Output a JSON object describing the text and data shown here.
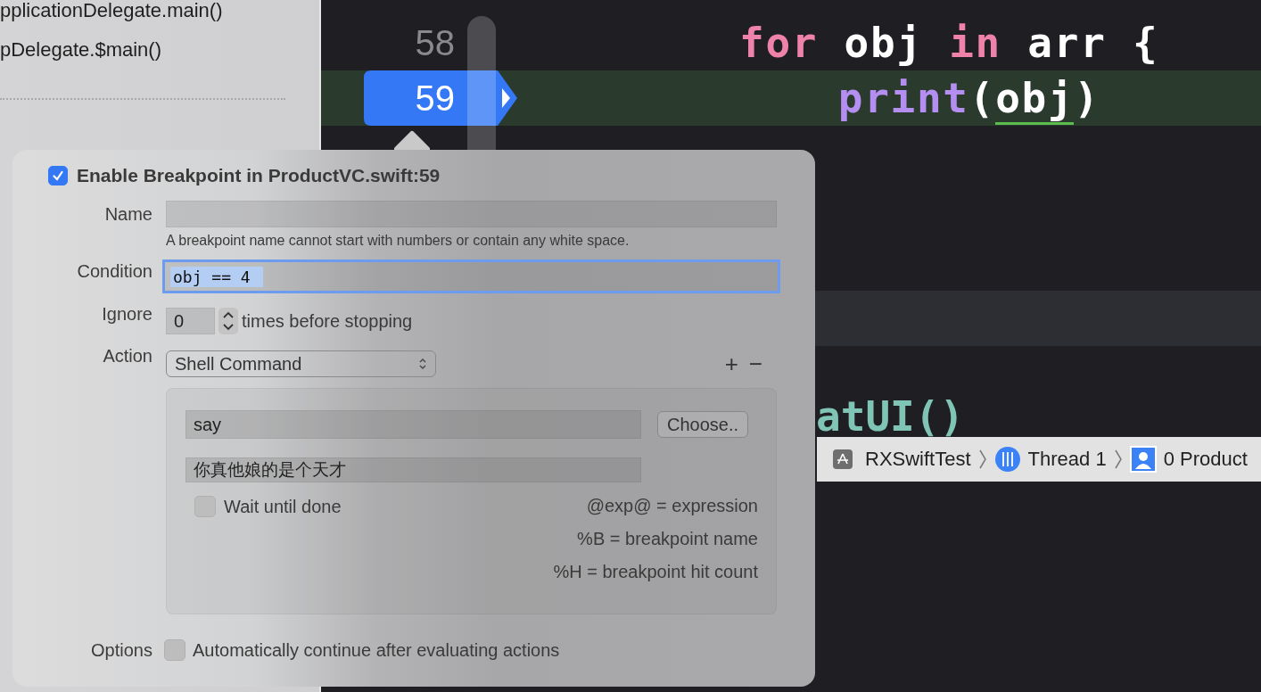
{
  "navigator": {
    "frames": [
      {
        "text": "pplicationDelegate.main()"
      },
      {
        "text": "pDelegate.$main()"
      }
    ]
  },
  "editor": {
    "lines": [
      {
        "number": "58",
        "breakpoint": false,
        "current": false,
        "tokens": [
          {
            "kind": "keyword",
            "text": "for"
          },
          {
            "kind": "plain",
            "text": " obj "
          },
          {
            "kind": "keyword",
            "text": "in"
          },
          {
            "kind": "plain",
            "text": " arr {"
          }
        ],
        "children": [
          {
            "number": "59",
            "breakpoint": true,
            "current": true,
            "tokens": [
              {
                "kind": "function",
                "text": "print"
              },
              {
                "kind": "plain",
                "text": "("
              },
              {
                "kind": "plain",
                "text": "obj",
                "underlined": true
              },
              {
                "kind": "plain",
                "text": ")"
              }
            ]
          }
        ]
      }
    ],
    "tail_code": "atUI()"
  },
  "debug_bar": {
    "items": [
      {
        "kind": "app",
        "label": "RXSwiftTest"
      },
      {
        "kind": "thread",
        "label": "Thread 1"
      },
      {
        "kind": "frame",
        "label": "0 Product"
      }
    ]
  },
  "popover": {
    "enabled": true,
    "title": "Enable Breakpoint in ProductVC.swift:59",
    "name": {
      "label": "Name",
      "hint": "A breakpoint name cannot start with numbers or contain any white space."
    },
    "condition": {
      "label": "Condition",
      "value": "obj == 4",
      "value_selected": true
    },
    "ignore": {
      "label": "Ignore",
      "value": "0",
      "suffix": "times before stopping"
    },
    "action": {
      "label": "Action",
      "value": "Shell Command",
      "add": "+",
      "remove": "−"
    },
    "shell": {
      "command": "say",
      "arguments": "你真他娘的是个天才",
      "choose": "Choose..",
      "wait_until_done": false,
      "wait_label": "Wait until done",
      "legend": [
        "@exp@ = expression",
        "%B = breakpoint name",
        "%H = breakpoint hit count"
      ]
    },
    "options": {
      "label": "Options",
      "auto_continue": false,
      "auto_continue_label": "Automatically continue after evaluating actions"
    }
  }
}
